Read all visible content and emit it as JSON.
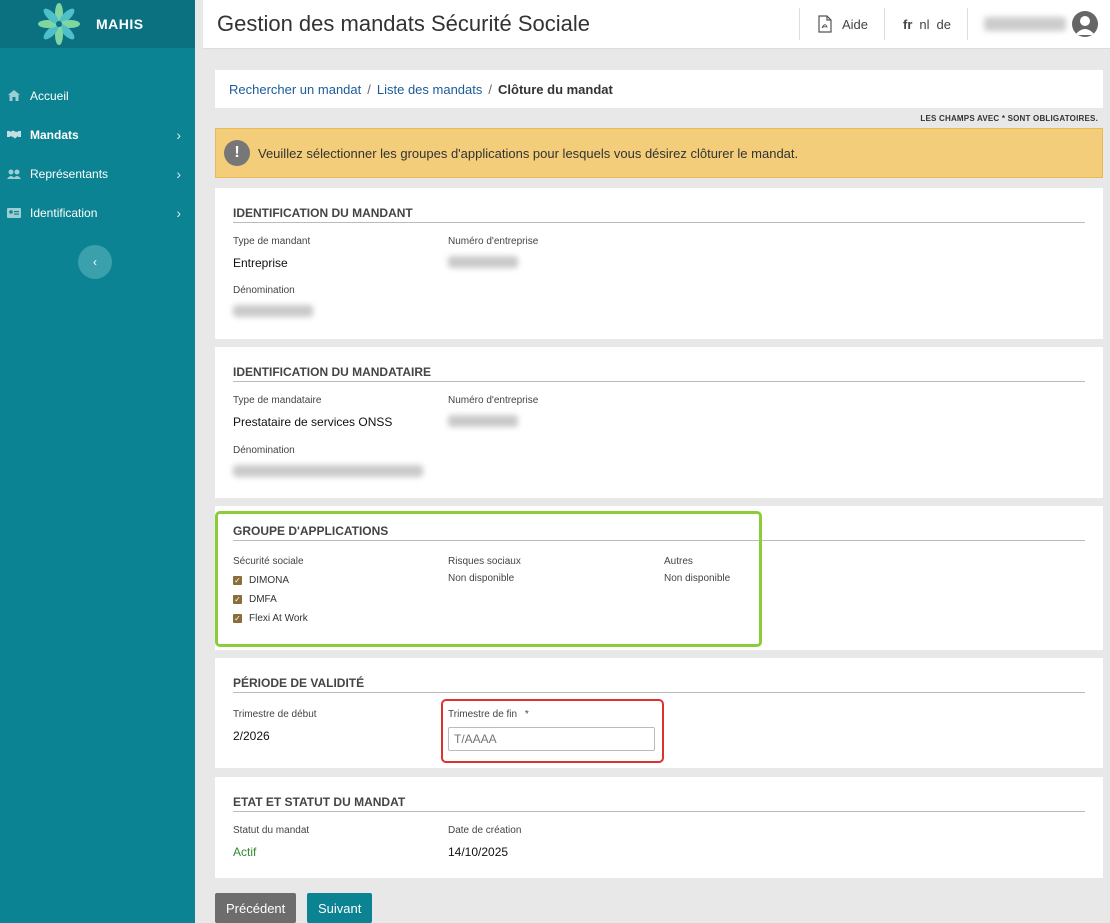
{
  "sidebar": {
    "brand": "MAHIS",
    "items": [
      {
        "label": "Accueil",
        "icon": "home-icon",
        "chevron": ""
      },
      {
        "label": "Mandats",
        "icon": "handshake-icon",
        "chevron": "›"
      },
      {
        "label": "Représentants",
        "icon": "users-icon",
        "chevron": "›"
      },
      {
        "label": "Identification",
        "icon": "id-card-icon",
        "chevron": "›"
      }
    ],
    "collapse": "‹"
  },
  "header": {
    "title": "Gestion des mandats Sécurité Sociale",
    "help": "Aide",
    "langs": [
      "fr",
      "nl",
      "de"
    ]
  },
  "breadcrumb": {
    "item1": "Rechercher un mandat",
    "item2": "Liste des mandats",
    "current": "Clôture du mandat",
    "sep": "/"
  },
  "required_note": "LES CHAMPS AVEC * SONT OBLIGATOIRES.",
  "alert": {
    "icon": "!",
    "text": "Veuillez sélectionner les groupes d'applications pour lesquels vous désirez clôturer le mandat."
  },
  "mandant": {
    "title": "IDENTIFICATION DU MANDANT",
    "type_label": "Type de mandant",
    "type_value": "Entreprise",
    "num_label": "Numéro d'entreprise",
    "denom_label": "Dénomination"
  },
  "mandataire": {
    "title": "IDENTIFICATION DU MANDATAIRE",
    "type_label": "Type de mandataire",
    "type_value": "Prestataire de services ONSS",
    "num_label": "Numéro d'entreprise",
    "denom_label": "Dénomination"
  },
  "groupes": {
    "title": "GROUPE D'APPLICATIONS",
    "col1": "Sécurité sociale",
    "col2": "Risques sociaux",
    "col3": "Autres",
    "col2_value": "Non disponible",
    "col3_value": "Non disponible",
    "apps": [
      "DIMONA",
      "DMFA",
      "Flexi At Work"
    ]
  },
  "periode": {
    "title": "PÉRIODE DE VALIDITÉ",
    "debut_label": "Trimestre de début",
    "debut_value": "2/2026",
    "fin_label": "Trimestre de fin",
    "required_mark": "*",
    "fin_placeholder": "T/AAAA"
  },
  "etat": {
    "title": "ETAT ET STATUT DU MANDAT",
    "statut_label": "Statut du mandat",
    "statut_value": "Actif",
    "date_label": "Date de création",
    "date_value": "14/10/2025"
  },
  "buttons": {
    "prev": "Précédent",
    "next": "Suivant"
  },
  "colors": {
    "sidebar": "#0b8392",
    "alert": "#f3cd7a",
    "active_status": "#2f8a2f",
    "highlight_green": "#8ccc3a",
    "highlight_red": "#e03030"
  }
}
